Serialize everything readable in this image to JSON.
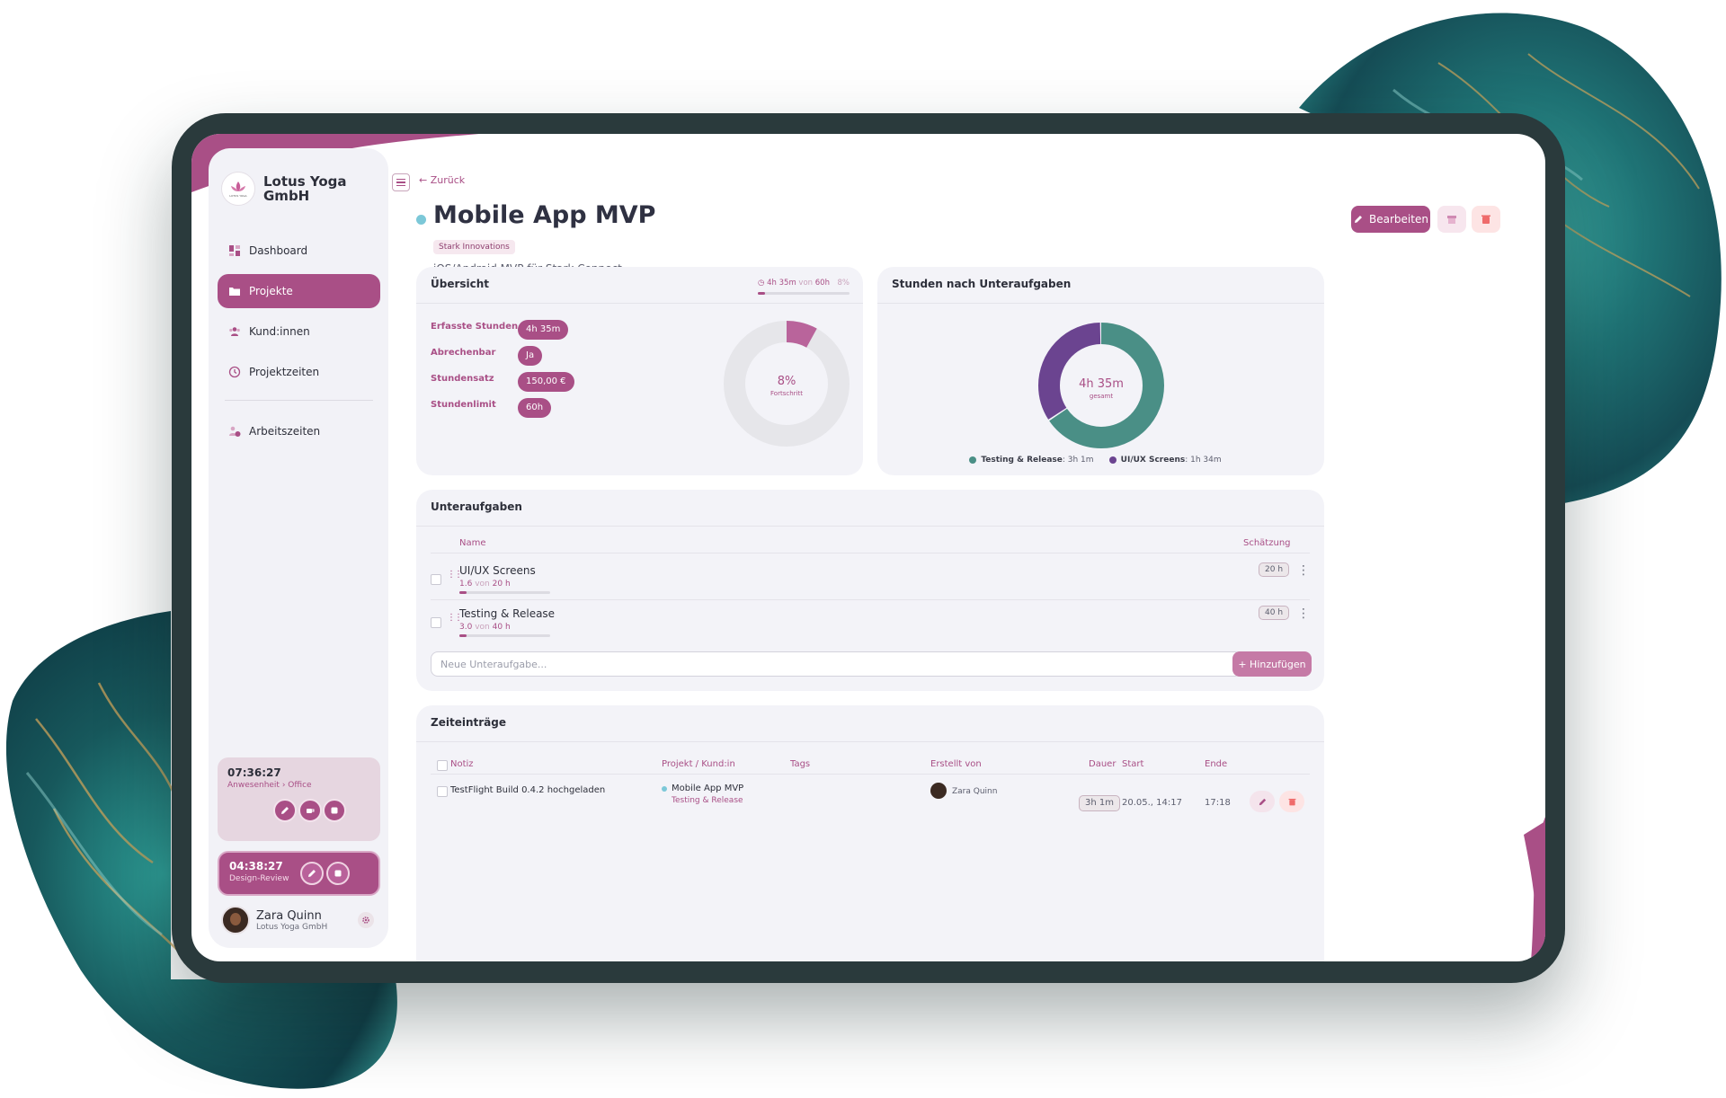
{
  "sidebar": {
    "brand": "Lotus Yoga GmbH",
    "logo_text": "LOTUS YOGA",
    "nav": [
      {
        "label": "Dashboard",
        "icon": "dashboard-icon"
      },
      {
        "label": "Projekte",
        "icon": "folder-icon"
      },
      {
        "label": "Kund:innen",
        "icon": "users-icon"
      },
      {
        "label": "Projektzeiten",
        "icon": "clock-icon"
      },
      {
        "label": "Arbeitszeiten",
        "icon": "user-clock-icon"
      }
    ],
    "timer1": {
      "time": "07:36:27",
      "sub": "Anwesenheit › Office"
    },
    "timer2": {
      "time": "04:38:27",
      "sub": "Design-Review"
    },
    "user": {
      "name": "Zara Quinn",
      "org": "Lotus Yoga GmbH"
    }
  },
  "header": {
    "back": "Zurück",
    "title": "Mobile App MVP",
    "client": "Stark Innovations",
    "description": "iOS/Android MVP für Stark Connect",
    "edit_label": "Bearbeiten"
  },
  "overview": {
    "title": "Übersicht",
    "hours_logged": "4h 35m",
    "von": "von",
    "hours_limit": "60h",
    "percent": "8%",
    "progress_fraction": 0.08,
    "stats": [
      {
        "label": "Erfasste Stunden",
        "value": "4h 35m"
      },
      {
        "label": "Abrechenbar",
        "value": "Ja"
      },
      {
        "label": "Stundensatz",
        "value": "150,00 €"
      },
      {
        "label": "Stundenlimit",
        "value": "60h"
      }
    ],
    "donut_value": "8%",
    "donut_label": "Fortschritt"
  },
  "hours_by_subtask": {
    "title": "Stunden nach Unteraufgaben",
    "total": "4h 35m",
    "total_label": "gesamt",
    "legend": [
      {
        "name": "Testing & Release",
        "value": "3h 1m",
        "color": "#4a8f86"
      },
      {
        "name": "UI/UX Screens",
        "value": "1h 34m",
        "color": "#6b4490"
      }
    ]
  },
  "chart_data": {
    "type": "pie",
    "categories": [
      "Testing & Release",
      "UI/UX Screens"
    ],
    "values": [
      181,
      94
    ],
    "unit": "min"
  },
  "subtasks": {
    "title": "Unteraufgaben",
    "col_name": "Name",
    "col_estimate": "Schätzung",
    "items": [
      {
        "name": "UI/UX Screens",
        "done": "1.6",
        "von": "von",
        "total": "20 h",
        "estimate": "20 h",
        "fraction": 0.08
      },
      {
        "name": "Testing & Release",
        "done": "3.0",
        "von": "von",
        "total": "40 h",
        "estimate": "40 h",
        "fraction": 0.075
      }
    ],
    "new_placeholder": "Neue Unteraufgabe...",
    "add_label": "+ Hinzufügen"
  },
  "time_entries": {
    "title": "Zeiteinträge",
    "columns": {
      "note": "Notiz",
      "project": "Projekt / Kund:in",
      "tags": "Tags",
      "created_by": "Erstellt von",
      "duration": "Dauer",
      "start": "Start",
      "end": "Ende"
    },
    "rows": [
      {
        "note": "TestFlight Build 0.4.2 hochgeladen",
        "project": "Mobile App MVP",
        "subtask": "Testing & Release",
        "user": "Zara Quinn",
        "duration": "3h 1m",
        "start": "20.05., 14:17",
        "end": "17:18"
      }
    ]
  },
  "colors": {
    "accent": "#a94f86",
    "frame": "#2a3a3c",
    "teal": "#4a8f86",
    "purple": "#6b4490"
  }
}
